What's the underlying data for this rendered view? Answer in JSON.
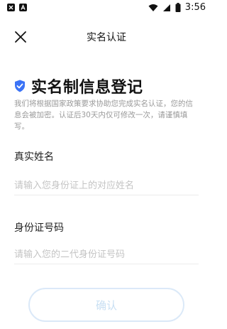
{
  "status_bar": {
    "time": "3:56"
  },
  "header": {
    "title": "实名认证",
    "close_icon": "close-icon"
  },
  "heading": {
    "title": "实名制信息登记",
    "icon": "shield-check-icon",
    "icon_color": "#3b73f6",
    "description": "我们将根据国家政策要求协助您完成实名认证，您的信息会被加密。认证后30天内仅可修改一次，请谨慎填写。"
  },
  "form": {
    "name": {
      "label": "真实姓名",
      "value": "",
      "placeholder": "请输入您身份证上的对应姓名"
    },
    "id_number": {
      "label": "身份证号码",
      "value": "",
      "placeholder": "请输入您的二代身份证号码"
    },
    "confirm_label": "确认"
  },
  "colors": {
    "primary": "#3b73f6",
    "button_text_disabled": "#c8dff3",
    "button_border_disabled": "#dbe9f8",
    "placeholder": "#c4c4c4",
    "description": "#9a9a9a"
  }
}
